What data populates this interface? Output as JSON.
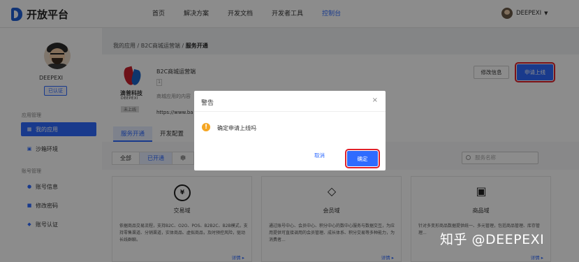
{
  "header": {
    "brand": "开放平台",
    "nav": [
      "首页",
      "解决方案",
      "开发文档",
      "开发者工具",
      "控制台"
    ],
    "active_nav": "控制台",
    "user": "DEEPEXI",
    "caret": "▼"
  },
  "sidebar": {
    "user_name": "DEEPEXI",
    "verified": "已认证",
    "app_section": "应用管理",
    "app_items": [
      {
        "label": "我的应用",
        "icon": "grid-icon"
      },
      {
        "label": "沙箱环境",
        "icon": "sandbox-icon"
      }
    ],
    "account_section": "账号管理",
    "account_items": [
      {
        "label": "账号信息",
        "icon": "user-icon"
      },
      {
        "label": "修改密码",
        "icon": "lock-icon"
      },
      {
        "label": "账号认证",
        "icon": "shield-icon"
      }
    ]
  },
  "breadcrumb": {
    "a": "我的应用",
    "b": "B2C商城运营端",
    "c": "服务开通",
    "sep": "/"
  },
  "app": {
    "logo_cn": "滴普科技",
    "logo_en": "DEEPEXI",
    "tag": "未上线",
    "name": "B2C商城运营端",
    "version": "1",
    "desc": "商城应用的内容",
    "url": "https://www.ba"
  },
  "actions": {
    "edit": "修改信息",
    "online": "申请上线"
  },
  "tabs": [
    "服务开通",
    "开发配置"
  ],
  "filters": [
    "全部",
    "已开通",
    "申"
  ],
  "search_placeholder": "服务名称",
  "modules": [
    {
      "icon": "¥",
      "title": "交易域",
      "desc": "依据商品交易流程，支持B2C、O2O、POS、B2B2C、B2B模式，支持零售渠道、分销渠道，实体商品、虚拟商品，及时预控风险，驱动长线群聊。",
      "more": "详情 ▸"
    },
    {
      "icon": "◇",
      "title": "会员域",
      "desc": "通过账号中心、会员中心、积分中心的数中心服务与数据交互，为应用提供可直接调用的会员管理、成长体系、积分交易等多种能力，为消费者...",
      "more": "详情 ▸"
    },
    {
      "icon": "▣",
      "title": "商品域",
      "desc": "针对多变形商品数据提供统一、多元管理，包括商品管理、库存管理...",
      "more": "详情 ▸"
    }
  ],
  "dialog": {
    "title": "警告",
    "close": "×",
    "message": "确定申请上线吗",
    "cancel": "取消",
    "ok": "确定"
  },
  "watermark": "知乎 @DEEPEXI"
}
